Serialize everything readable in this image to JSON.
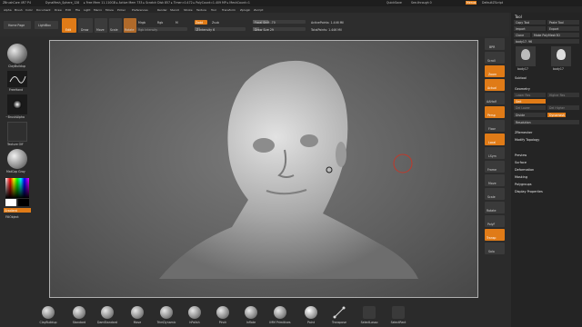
{
  "titlebar": {
    "title": "ZBrushCore 4R7 P4",
    "doc": "DynaMesh_Sphere_128",
    "stats": "▸ Free Mem 11.110GB ▸ Active Mem 733 ▸ Scratch Disk 857 ▸ Timer=0.472 ▸ PolyCount=1.409 MP ▸ MeshCount=1",
    "quicksave": "QuickSave",
    "seethrough": "See-through 0",
    "menus": "Menus",
    "script": "DefaultZScript"
  },
  "menubar": {
    "items": [
      "Alpha",
      "Brush",
      "Color",
      "Document",
      "Draw",
      "Edit",
      "File",
      "Light",
      "Macro",
      "Movie",
      "Picker",
      "Preferences",
      "Render",
      "Stencil",
      "Stroke",
      "Texture",
      "Tool",
      "Transform",
      "Zplugin",
      "Zscript"
    ]
  },
  "toolbar": {
    "home": "Home Page",
    "lightbox": "LightBox",
    "edit": "Edit",
    "draw": "Draw",
    "move": "Move",
    "scale": "Scale",
    "rotate": "Rotate",
    "mrgb": "Mrgb",
    "rgb": "Rgb",
    "m": "M",
    "zadd": "Zadd",
    "zsub": "Zsub",
    "rgb_intensity": "Rgb Intensity",
    "z_intensity": "Z Intensity 6",
    "focal_shift": "Focal Shift -70",
    "draw_size": "Draw Size 29",
    "active_points": "ActivePoints: 1.446 Mil",
    "total_points": "TotalPoints: 1.446 Mil",
    "coords": "0.656,-33.590,0.678"
  },
  "leftshelf": {
    "brush": "ClayBuildup",
    "stroke": "FreeHand",
    "alpha": "~BrushAlpha",
    "texture": "Texture Off",
    "material": "MatCap Gray",
    "gradient": "Gradient",
    "switch": "SwitchColor",
    "alternate": "Alternate",
    "fill": "FillObject"
  },
  "rightshelf": {
    "items": [
      "BPR",
      "Scroll",
      "Zoom",
      "Actual",
      "AAHalf",
      "Persp",
      "Floor",
      "Local",
      "LSym",
      "Frame",
      "Move",
      "Scale",
      "Rotate",
      "PolyF",
      "Transp",
      "Solo"
    ]
  },
  "panel": {
    "title": "Tool",
    "copy_tool": "Copy Tool",
    "paste_tool": "Paste Tool",
    "import": "Import",
    "export": "Export",
    "clone": "Clone",
    "make_polymesh": "Make PolyMesh3D",
    "tool_name": "body17. 96",
    "thumb1": "body17",
    "thumb2": "body17",
    "subtool": "Subtool",
    "geometry": "Geometry",
    "lower_res": "Lower Res",
    "higher_res": "Higher Res",
    "divide": "Divide",
    "dynamesh": "Dynamesh",
    "resolution": "Resolution",
    "del_lower": "Del Lower",
    "del_higher": "Del Higher",
    "smt": "Smt",
    "zremesher": "ZRemesher",
    "modify_topology": "Modify Topology",
    "masking": "Masking",
    "polygroups": "Polygroups",
    "display_properties": "Display Properties",
    "sections": [
      "Preview",
      "Surface",
      "Deformation",
      "Masking",
      "Polygroups",
      "Display Properties"
    ]
  },
  "bottombar": {
    "brushes": [
      "ClayBuildup",
      "Standard",
      "DamStandard",
      "Move",
      "TrimDynamic",
      "hPolish",
      "Pinch",
      "Inflate",
      "IMM Primitives",
      "Paint",
      "Transpose",
      "SelectLasso",
      "SelectRect"
    ]
  },
  "colors": {
    "accent": "#e07b17",
    "cursor_ring": "#c0392b"
  }
}
